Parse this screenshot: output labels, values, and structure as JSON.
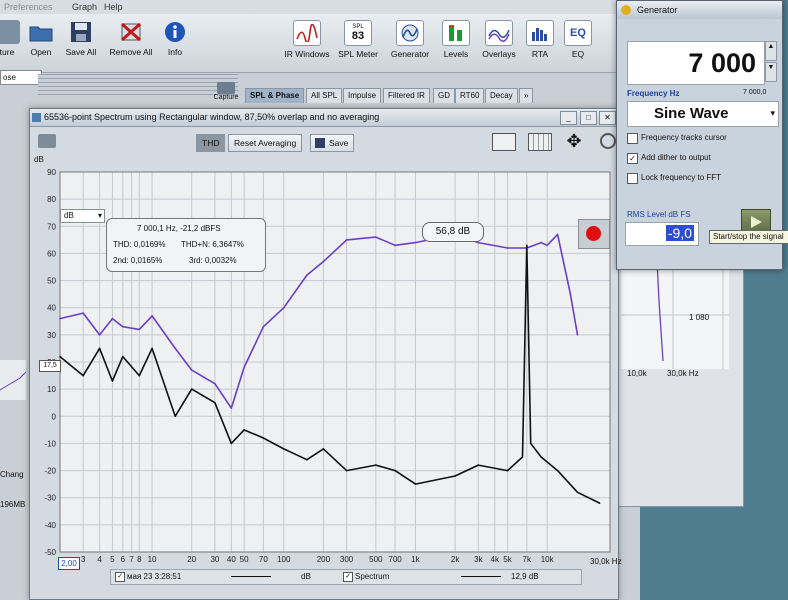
{
  "menubar": {
    "items": [
      "Preferences",
      "Graph",
      "Help"
    ]
  },
  "toolbar": {
    "left_buttons": [
      {
        "label": "ture",
        "icon": "capture-icon"
      },
      {
        "label": "Open",
        "icon": "folder-icon"
      },
      {
        "label": "Save All",
        "icon": "save-icon"
      },
      {
        "label": "Remove All",
        "icon": "remove-icon"
      },
      {
        "label": "Info",
        "icon": "info-icon"
      }
    ],
    "right_buttons": [
      {
        "label": "IR Windows",
        "icon": "ir-windows-icon"
      },
      {
        "label": "SPL Meter",
        "icon": "spl-meter-icon",
        "badge": "83",
        "badge_top": "SPL"
      },
      {
        "label": "Generator",
        "icon": "generator-icon"
      },
      {
        "label": "Levels",
        "icon": "levels-icon"
      },
      {
        "label": "Overlays",
        "icon": "overlays-icon"
      },
      {
        "label": "RTA",
        "icon": "rta-icon"
      },
      {
        "label": "EQ",
        "icon": "eq-icon",
        "badge": "EQ"
      }
    ]
  },
  "left_panel": {
    "dropdown": "ose",
    "capture_label": "Capture",
    "change_label": "Chang",
    "memory_label": "196MB"
  },
  "tabs": [
    "SPL & Phase",
    "All SPL",
    "Impulse",
    "Filtered IR",
    "GD",
    "RT60",
    "Decay",
    "»"
  ],
  "background_graph": {
    "label1": "1 080",
    "xlab1": "10,0k",
    "xlab2": "30,0k Hz"
  },
  "spectrum_window": {
    "title": "65536-point Spectrum using Rectangular window, 87,50% overlap and no averaging",
    "buttons": {
      "thd": "THD",
      "reset": "Reset Averaging",
      "save": "Save"
    },
    "thd_box": {
      "heading": "7 000,1 Hz, -21,2 dBFS",
      "thd": "THD: 0,0169%",
      "thd_n": "THD+N: 6,3647%",
      "h2": "2nd: 0,0165%",
      "h3": "3rd: 0,0032%"
    },
    "spl_readout": "56,8 dB",
    "unit_dropdown": "dB",
    "y_unit": "dB",
    "y_marker": "17,5",
    "x_start": "2,00",
    "x_end": "30,0k Hz",
    "legend": {
      "left": "мая 23 3:28:51",
      "mid_unit": "dB",
      "spectrum": "Spectrum",
      "right_value": "12,9 dB"
    }
  },
  "chart_data": {
    "type": "line",
    "title": "",
    "xlabel": "",
    "ylabel": "dB",
    "x_scale": "log",
    "xlim": [
      2,
      30000
    ],
    "ylim": [
      -50,
      90
    ],
    "grid": true,
    "x_tick_labels": [
      "3",
      "4",
      "5",
      "6",
      "7",
      "8",
      "10",
      "20",
      "30",
      "40",
      "50",
      "70",
      "100",
      "200",
      "300",
      "500",
      "700",
      "1k",
      "2k",
      "3k",
      "4k",
      "5k",
      "7k",
      "10k",
      "30,0k Hz"
    ],
    "y_tick_labels": [
      "90",
      "80",
      "70",
      "60",
      "50",
      "40",
      "30",
      "20",
      "10",
      "0",
      "-10",
      "-20",
      "-30",
      "-40",
      "-50"
    ],
    "series": [
      {
        "color": "#6a3fc8",
        "x": [
          2,
          3,
          4,
          5,
          6,
          8,
          10,
          15,
          20,
          30,
          40,
          50,
          70,
          100,
          150,
          200,
          300,
          500,
          700,
          1000,
          2000,
          3000,
          5000,
          7000,
          9000,
          10000,
          12000,
          15000,
          17000
        ],
        "y": [
          36,
          38,
          30,
          36,
          33,
          32,
          37,
          25,
          17,
          12,
          3,
          18,
          33,
          40,
          52,
          57,
          65,
          66,
          63,
          64,
          67,
          64,
          62,
          62,
          64,
          63,
          67,
          45,
          30
        ]
      },
      {
        "color": "#111111",
        "x": [
          2,
          3,
          4,
          5,
          6,
          8,
          10,
          15,
          20,
          30,
          40,
          50,
          70,
          100,
          150,
          200,
          300,
          500,
          700,
          1000,
          2000,
          3000,
          5000,
          6500,
          7000,
          7500,
          9000,
          12000,
          17000,
          25000
        ],
        "y": [
          22,
          15,
          25,
          13,
          22,
          15,
          25,
          0,
          10,
          5,
          -10,
          -5,
          -8,
          -12,
          -16,
          -12,
          -20,
          -18,
          -20,
          -25,
          -22,
          -18,
          -20,
          -15,
          63,
          -10,
          -15,
          -20,
          -28,
          -32
        ]
      }
    ]
  },
  "generator": {
    "title": "Generator",
    "frequency_value": "7 000",
    "frequency_label": "Frequency Hz",
    "frequency_small": "7 000,0",
    "waveform": "Sine Wave",
    "checkboxes": [
      {
        "label": "Frequency tracks cursor",
        "checked": false
      },
      {
        "label": "Add dither to output",
        "checked": true
      },
      {
        "label": "Lock frequency to FFT",
        "checked": false
      }
    ],
    "rms_label": "RMS Level dB FS",
    "rms_value": "-9,0",
    "tooltip": "Start/stop the signal"
  }
}
